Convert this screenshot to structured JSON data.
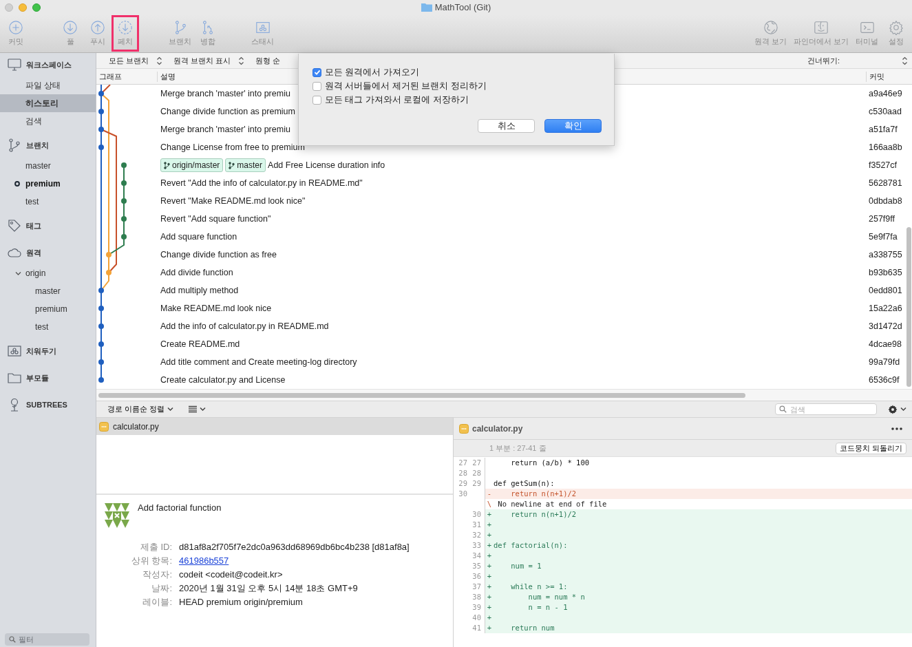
{
  "window": {
    "title": "MathTool (Git)"
  },
  "toolbar": {
    "left": [
      [
        {
          "kind": "commit",
          "label": "커밋",
          "highlighted": false
        }
      ],
      [
        {
          "kind": "pull",
          "label": "풀",
          "highlighted": false
        },
        {
          "kind": "push",
          "label": "푸시",
          "highlighted": false
        },
        {
          "kind": "fetch",
          "label": "페치",
          "highlighted": true
        }
      ],
      [
        {
          "kind": "branch",
          "label": "브랜치",
          "highlighted": false
        },
        {
          "kind": "merge",
          "label": "병합",
          "highlighted": false
        }
      ],
      [
        {
          "kind": "stash",
          "label": "스태시",
          "highlighted": false
        }
      ]
    ],
    "right": [
      [
        {
          "kind": "remote",
          "label": "원격 보기",
          "highlighted": false
        },
        {
          "kind": "finder",
          "label": "파인더에서 보기",
          "highlighted": false
        },
        {
          "kind": "terminal",
          "label": "터미널",
          "highlighted": false
        },
        {
          "kind": "settings",
          "label": "설정",
          "highlighted": false
        }
      ]
    ]
  },
  "sidebar": {
    "sections": [
      {
        "kind": "workspace",
        "title": "워크스페이스",
        "items": [
          {
            "label": "파일 상태",
            "selected": false
          },
          {
            "label": "히스토리",
            "selected": true
          },
          {
            "label": "검색",
            "selected": false
          }
        ]
      },
      {
        "kind": "branches",
        "title": "브랜치",
        "items": [
          {
            "label": "master",
            "selected": false,
            "current": false
          },
          {
            "label": "premium",
            "selected": false,
            "current": true
          },
          {
            "label": "test",
            "selected": false,
            "current": false
          }
        ]
      },
      {
        "kind": "tags",
        "title": "태그"
      },
      {
        "kind": "remotes",
        "title": "원격",
        "items": [
          {
            "label": "origin",
            "selected": false,
            "expanded": true,
            "children": [
              {
                "label": "master",
                "selected": false
              },
              {
                "label": "premium",
                "selected": false
              },
              {
                "label": "test",
                "selected": false
              }
            ]
          }
        ]
      },
      {
        "kind": "stashes",
        "title": "치워두기"
      },
      {
        "kind": "submodules",
        "title": "부모듈"
      },
      {
        "kind": "subtrees",
        "title": "SUBTREES"
      }
    ],
    "filter_placeholder": "필터"
  },
  "history_filter": {
    "controls": [
      {
        "kind": "popup",
        "label": "모든 브랜치"
      },
      {
        "kind": "popup",
        "label": "원격 브랜치 표시"
      },
      {
        "kind": "plain",
        "label": "원형 순"
      }
    ],
    "jump": "건너뛰기:"
  },
  "history": {
    "columns": [
      "그래프",
      "설명",
      "커밋"
    ],
    "rows": [
      {
        "description": "Merge branch 'master' into premiu",
        "commit": "a9a46e9"
      },
      {
        "description": "Change divide function as premium",
        "commit": "c530aad"
      },
      {
        "description": "Merge branch 'master' into premiu",
        "commit": "a51fa7f"
      },
      {
        "description": "Change License from free to premium",
        "commit": "166aa8b"
      },
      {
        "refs": [
          "origin/master",
          "master"
        ],
        "description": "Add Free License duration info",
        "commit": "f3527cf"
      },
      {
        "description": "Revert \"Add the info of calculator.py in README.md\"",
        "commit": "5628781"
      },
      {
        "description": "Revert \"Make README.md look nice\"",
        "commit": "0dbdab8"
      },
      {
        "description": "Revert \"Add square function\"",
        "commit": "257f9ff"
      },
      {
        "description": "Add square function",
        "commit": "5e9f7fa"
      },
      {
        "description": "Change divide function as free",
        "commit": "a338755"
      },
      {
        "description": "Add divide function",
        "commit": "b93b635"
      },
      {
        "description": "Add multiply method",
        "commit": "0edd801"
      },
      {
        "description": "Make README.md look nice",
        "commit": "15a22a6"
      },
      {
        "description": "Add the info of calculator.py in README.md",
        "commit": "3d1472d"
      },
      {
        "description": "Create README.md",
        "commit": "4dcae98"
      },
      {
        "description": "Add title comment and Create meeting-log directory",
        "commit": "99a79fd"
      },
      {
        "description": "Create calculator.py and License",
        "commit": "6536c9f"
      }
    ]
  },
  "file_toolbar": {
    "sort": "경로 이름순 정렬",
    "search_placeholder": "검색"
  },
  "files": [
    {
      "name": "calculator.py",
      "selected": true
    }
  ],
  "details": {
    "message": "Add factorial function",
    "fields": [
      {
        "label": "제출 ID:",
        "value": "d81af8a2f705f7e2dc0a963dd68969db6bc4b238 [d81af8a]",
        "kind": "text"
      },
      {
        "label": "상위 항목:",
        "value": "461986b557",
        "kind": "link"
      },
      {
        "label": "작성자:",
        "value": "codeit <codeit@codeit.kr>",
        "kind": "text"
      },
      {
        "label": "날짜:",
        "value": "2020년 1월 31일 오후 5시 14분 18초 GMT+9",
        "kind": "text"
      },
      {
        "label": "레이블:",
        "value": "HEAD premium origin/premium",
        "kind": "text"
      }
    ]
  },
  "diff": {
    "file": "calculator.py",
    "hunk": {
      "title": "1 부분 : 27-41 줄",
      "action": "코드뭉치 되돌리기"
    },
    "lines": [
      {
        "kind": "context",
        "old": "27",
        "new": "27",
        "code": "    return (a/b) * 100"
      },
      {
        "kind": "context",
        "old": "28",
        "new": "28"
      },
      {
        "kind": "context",
        "old": "29",
        "new": "29",
        "code": "def getSum(n):"
      },
      {
        "kind": "removed",
        "old": "30",
        "marker": "-",
        "code": "    return n(n+1)/2"
      },
      {
        "kind": "note",
        "marker": "\\",
        "code": " No newline at end of file"
      },
      {
        "kind": "added",
        "new": "30",
        "marker": "+",
        "code": "    return n(n+1)/2"
      },
      {
        "kind": "added",
        "new": "31",
        "marker": "+"
      },
      {
        "kind": "added",
        "new": "32",
        "marker": "+"
      },
      {
        "kind": "added",
        "new": "33",
        "marker": "+",
        "code": "def factorial(n):"
      },
      {
        "kind": "added",
        "new": "34",
        "marker": "+"
      },
      {
        "kind": "added",
        "new": "35",
        "marker": "+",
        "code": "    num = 1"
      },
      {
        "kind": "added",
        "new": "36",
        "marker": "+"
      },
      {
        "kind": "added",
        "new": "37",
        "marker": "+",
        "code": "    while n >= 1:"
      },
      {
        "kind": "added",
        "new": "38",
        "marker": "+",
        "code": "        num = num * n"
      },
      {
        "kind": "added",
        "new": "39",
        "marker": "+",
        "code": "        n = n - 1"
      },
      {
        "kind": "added",
        "new": "40",
        "marker": "+"
      },
      {
        "kind": "added",
        "new": "41",
        "marker": "+",
        "code": "    return num"
      }
    ]
  },
  "fetch_dialog": {
    "options": [
      {
        "label": "모든 원격에서 가져오기",
        "checked": true
      },
      {
        "label": "원격 서버들에서 제거된 브랜치 정리하기",
        "checked": false
      },
      {
        "label": "모든 태그 가져와서 로컬에 저장하기",
        "checked": false
      }
    ],
    "buttons": [
      {
        "kind": "cancel",
        "label": "취소"
      },
      {
        "kind": "default",
        "label": "확인"
      }
    ]
  }
}
